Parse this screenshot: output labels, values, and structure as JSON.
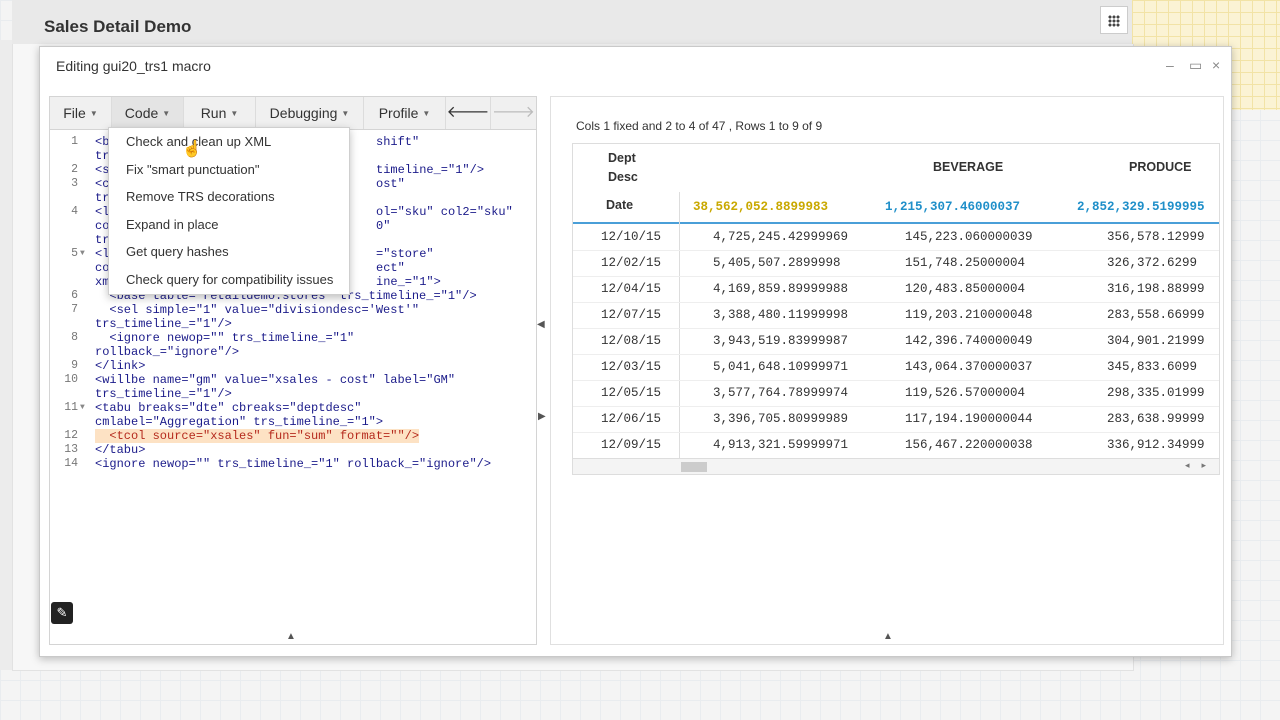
{
  "app": {
    "title": "Sales Detail Demo"
  },
  "dialog": {
    "title": "Editing gui20_trs1 macro"
  },
  "toolbar": {
    "file": "File",
    "code": "Code",
    "run": "Run",
    "debugging": "Debugging",
    "profile": "Profile",
    "back_icon": "arrow-left-icon",
    "forward_icon": "arrow-right-icon"
  },
  "code_menu": {
    "items": [
      "Check and clean up XML",
      "Fix \"smart punctuation\"",
      "Remove TRS decorations",
      "Expand in place",
      "Get query hashes",
      "Check query for compatibility issues"
    ]
  },
  "editor": {
    "line_numbers": [
      "1",
      "2",
      "3",
      "4",
      "5",
      "6",
      "7",
      "8",
      "9",
      "10",
      "11",
      "12",
      "13",
      "14"
    ],
    "visible_fragments": {
      "l1a": "<ba",
      "l1b": "shift\"",
      "l1c": "tr",
      "l2a": "<se",
      "l2b": "timeline_=\"1\"/>",
      "l3a": "<co",
      "l3b": "ost\"",
      "l3c": "tr",
      "l4a": "<li",
      "l4b": "ol=\"sku\" col2=\"sku\"",
      "l4c": "co",
      "l4d": "0\"",
      "l4e": "tr",
      "l5a": "<li",
      "l5b": "=\"store\"",
      "l5c": "co",
      "l5d": "ect\"",
      "l5e": "xm",
      "l5f": "ine_=\"1\">",
      "l6": "  <base table=\"retaildemo.stores\" trs_timeline_=\"1\"/>",
      "l7a": "  <sel simple=\"1\" value=\"divisiondesc='West'\"",
      "l7b": "trs_timeline_=\"1\"/>",
      "l8a": "  <ignore newop=\"\" trs_timeline_=\"1\"",
      "l8b": "rollback_=\"ignore\"/>",
      "l9": "</link>",
      "l10a": "<willbe name=\"gm\" value=\"xsales - cost\" label=\"GM\"",
      "l10b": "trs_timeline_=\"1\"/>",
      "l11a": "<tabu breaks=\"dte\" cbreaks=\"deptdesc\"",
      "l11b": "cmlabel=\"Aggregation\" trs_timeline_=\"1\">",
      "l12": "  <tcol source=\"xsales\" fun=\"sum\" format=\"\"/>",
      "l13": "</tabu>",
      "l14": "<ignore newop=\"\" trs_timeline_=\"1\" rollback_=\"ignore\"/>"
    }
  },
  "results": {
    "summary": "Cols 1 fixed and 2 to 4 of 47 , Rows 1 to 9 of 9",
    "header": {
      "dept_desc": "Dept\nDesc",
      "date": "Date",
      "col1": "BEVERAGE",
      "col2": "PRODUCE"
    },
    "totals": [
      "38,562,052.8899983",
      "1,215,307.46000037",
      "2,852,329.5199995"
    ],
    "total_colors": [
      "#c9a800",
      "#1f8fc9",
      "#1f8fc9"
    ],
    "rows": [
      [
        "12/10/15",
        "4,725,245.42999969",
        "145,223.060000039",
        "356,578.12999"
      ],
      [
        "12/02/15",
        "5,405,507.2899998",
        "151,748.25000004",
        "326,372.6299"
      ],
      [
        "12/04/15",
        "4,169,859.89999988",
        "120,483.85000004",
        "316,198.88999"
      ],
      [
        "12/07/15",
        "3,388,480.11999998",
        "119,203.210000048",
        "283,558.66999"
      ],
      [
        "12/08/15",
        "3,943,519.83999987",
        "142,396.740000049",
        "304,901.21999"
      ],
      [
        "12/03/15",
        "5,041,648.10999971",
        "143,064.370000037",
        "345,833.6099"
      ],
      [
        "12/05/15",
        "3,577,764.78999974",
        "119,526.57000004",
        "298,335.01999"
      ],
      [
        "12/06/15",
        "3,396,705.80999989",
        "117,194.190000044",
        "283,638.99999"
      ],
      [
        "12/09/15",
        "4,913,321.59999971",
        "156,467.220000038",
        "336,912.34999"
      ]
    ]
  }
}
